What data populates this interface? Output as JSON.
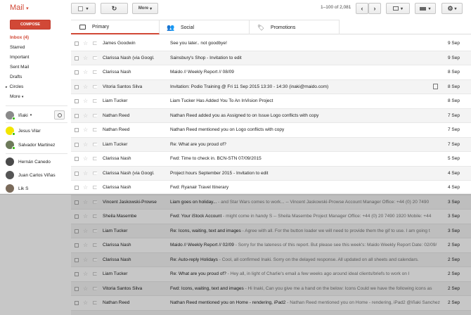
{
  "app": {
    "brand": "Mail"
  },
  "toolbar": {
    "more_label": "More",
    "range": "1–100 of 2,081"
  },
  "sidebar": {
    "compose_label": "COMPOSE",
    "items": [
      {
        "label": "Inbox (4)"
      },
      {
        "label": "Starred"
      },
      {
        "label": "Important"
      },
      {
        "label": "Sent Mail"
      },
      {
        "label": "Drafts"
      },
      {
        "label": "Circles"
      },
      {
        "label": "More"
      }
    ],
    "chat": {
      "me": "Iñaki",
      "contacts": [
        {
          "name": "Jesus Vilar"
        },
        {
          "name": "Salvador Martinez"
        },
        {
          "name": "Hernán Canedo"
        },
        {
          "name": "Juan Carlos Viñas"
        },
        {
          "name": "Lik S"
        }
      ]
    }
  },
  "tabs": [
    {
      "label": "Primary"
    },
    {
      "label": "Social"
    },
    {
      "label": "Promotions"
    }
  ],
  "emails": [
    {
      "sender": "James Goodwin",
      "subject": "See you later.. not goodbye!",
      "snippet": "",
      "date": "9 Sep"
    },
    {
      "sender": "Clarissa Nash (via Googl.",
      "subject": "Sainsbury's Shop - Invitation to edit",
      "snippet": "",
      "date": "9 Sep"
    },
    {
      "sender": "Clarissa Nash",
      "subject": "Maido // Weekly Report // 08/09",
      "snippet": "",
      "date": "8 Sep"
    },
    {
      "sender": "Vitoria Santos Silva",
      "subject": "Invitation: Podio Training @ Fri 11 Sep 2015 13:30 - 14:30 (inaki@maido.com)",
      "snippet": "",
      "date": "8 Sep"
    },
    {
      "sender": "Liam Tucker",
      "subject": "Liam Tucker Has Added You To An InVision Project",
      "snippet": "",
      "date": "8 Sep"
    },
    {
      "sender": "Nathan Reed",
      "subject": "Nathan Reed added you as Assigned to on Issue Logo conflicts with copy",
      "snippet": "",
      "date": "7 Sep"
    },
    {
      "sender": "Nathan Reed",
      "subject": "Nathan Reed mentioned you on Logo conflicts with copy",
      "snippet": "",
      "date": "7 Sep"
    },
    {
      "sender": "Liam Tucker",
      "subject": "Re: What are you proud of?",
      "snippet": "",
      "date": "7 Sep"
    },
    {
      "sender": "Clarissa Nash",
      "subject": "Fwd: Time to check in. BCN-STN 07/09/2015",
      "snippet": "",
      "date": "5 Sep"
    },
    {
      "sender": "Clarissa Nash (via Googl.",
      "subject": "Project hours September 2015 - Invitation to edit",
      "snippet": "",
      "date": "4 Sep"
    },
    {
      "sender": "Clarissa Nash",
      "subject": "Fwd: Ryanair Travel Itinerary",
      "snippet": "",
      "date": "4 Sep"
    },
    {
      "sender": "Vincent Jaskowski-Prowse",
      "subject": "Liam goes on holiday...",
      "snippet": " - and Star Wars comes to work... -- Vincent Jaskowski-Prowse Account Manager Office: +44 (0) 20 7490",
      "date": "3 Sep"
    },
    {
      "sender": "Sheila Masembe",
      "subject": "Fwd: Your iStock Account",
      "snippet": " - might come in handy S -- Sheila Masembe Project Manager Office: +44 (0) 20 7490 1920 Mobile: +44",
      "date": "3 Sep"
    },
    {
      "sender": "Liam Tucker",
      "subject": "Re: Icons, waiting, text and images",
      "snippet": " - Agree with all. For the button loader we will need to provide them the gif to use. I am going t",
      "date": "3 Sep"
    },
    {
      "sender": "Clarissa Nash",
      "subject": "Maido // Weekly Report // 02/09",
      "snippet": " - Sorry for the lateness of this report. But please see this week's: Maido Weekly Report Date: 02/09/",
      "date": "2 Sep"
    },
    {
      "sender": "Clarissa Nash",
      "subject": "Re: Auto-reply Holidays",
      "snippet": " - Cool, all confirmed Inaki. Sorry on the delayed response. All updated on all sheets and calendars.",
      "date": "2 Sep"
    },
    {
      "sender": "Liam Tucker",
      "subject": "Re: What are you proud of?",
      "snippet": " - Hey all, in light of Charlie's email a few weeks ago around ideal clients/briefs to work on I",
      "date": "2 Sep"
    },
    {
      "sender": "Vitoria Santos Silva",
      "subject": "Fwd: Icons, waiting, text and images",
      "snippet": " - Hi Inaki, Can you give me a hand on the below: Icons Could we have the following icons as",
      "date": "2 Sep"
    },
    {
      "sender": "Nathan Reed",
      "subject": "Nathan Reed mentioned you on Home - rendering, iPad2",
      "snippet": " - Nathan Reed mentioned you on Home - rendering, iPad2 @Iñaki Sanchez",
      "date": "2 Sep"
    },
    {
      "sender": "Liam Tucker",
      "subject": "Re: Barcelona trip!!",
      "snippet": " - All sounds great man! Thanks! Nothing special we want to visit I don't think - anything is good",
      "date": "2 Sep"
    }
  ]
}
